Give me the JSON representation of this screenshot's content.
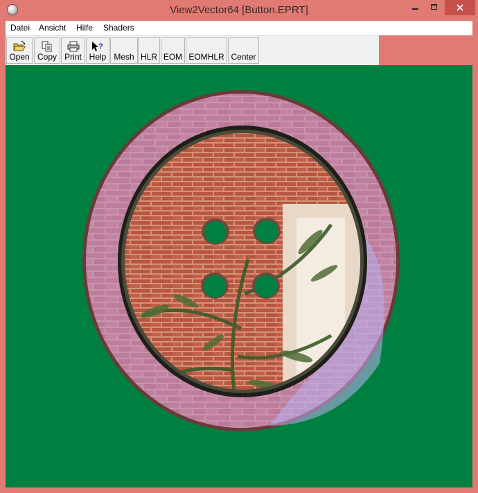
{
  "window": {
    "title": "View2Vector64 [Button.EPRT]"
  },
  "menu": {
    "items": [
      "Datei",
      "Ansicht",
      "Hilfe",
      "Shaders"
    ]
  },
  "toolbar": {
    "open_label": "Open",
    "copy_label": "Copy",
    "print_label": "Print",
    "help_label": "Help",
    "mesh_label": "Mesh",
    "hlr_label": "HLR",
    "eom_label": "EOM",
    "eomhlr_label": "EOMHLR",
    "center_label": "Center"
  },
  "colors": {
    "frame": "#e07a73",
    "viewport_background": "#008040",
    "close_button": "#c7504a"
  },
  "viewport": {
    "object": "button-model",
    "icons": [
      "open-folder-icon",
      "copy-icon",
      "print-icon",
      "help-pointer-icon"
    ]
  }
}
